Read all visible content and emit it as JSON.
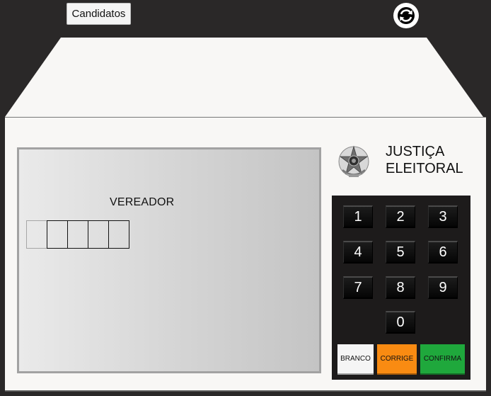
{
  "toolbar": {
    "candidatos_label": "Candidatos",
    "refresh_icon": "refresh-icon"
  },
  "screen": {
    "office": "VEREADOR",
    "digits": [
      "",
      "",
      "",
      "",
      ""
    ]
  },
  "brand": {
    "line1": "JUSTIÇA",
    "line2": "ELEITORAL",
    "emblem_icon": "coat-of-arms-icon"
  },
  "keypad": {
    "keys": [
      "1",
      "2",
      "3",
      "4",
      "5",
      "6",
      "7",
      "8",
      "9",
      "0"
    ],
    "branco": "BRANCO",
    "corrige": "CORRIGE",
    "confirma": "CONFIRMA"
  },
  "colors": {
    "background": "#2a2828",
    "case": "#f8f7f5",
    "branco": "#f5f5f5",
    "corrige": "#f98b12",
    "confirma": "#1fa83c",
    "keypad": "#1d1b1b"
  }
}
